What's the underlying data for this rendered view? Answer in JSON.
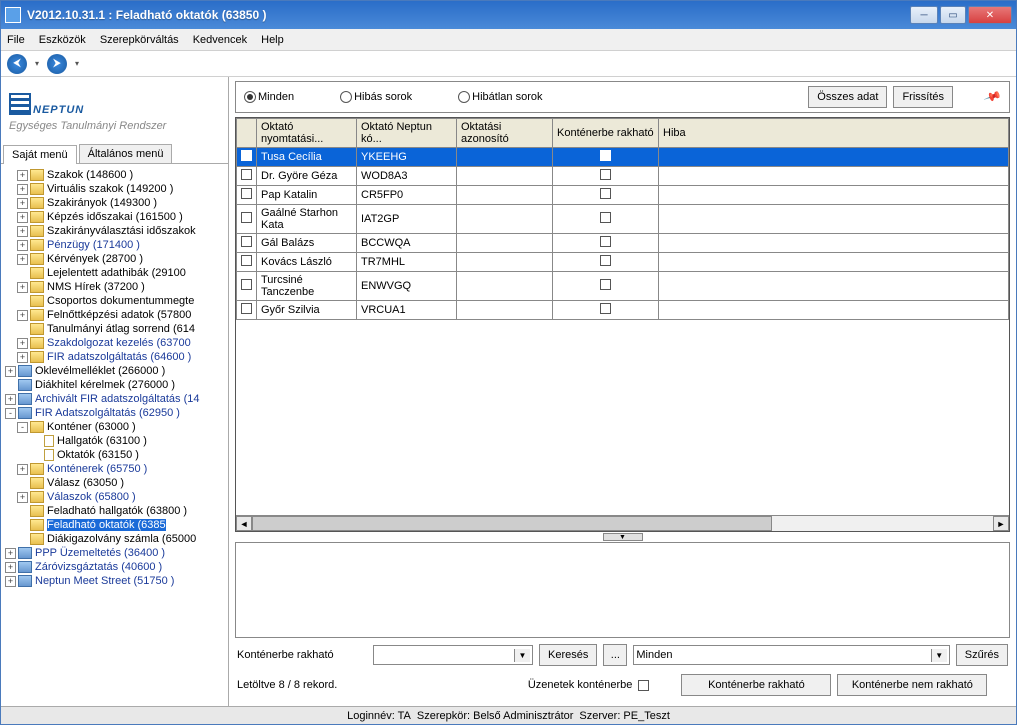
{
  "title": "V2012.10.31.1 : Feladható oktatók (63850  )",
  "menu": [
    "File",
    "Eszközök",
    "Szerepkörváltás",
    "Kedvencek",
    "Help"
  ],
  "logo": {
    "text": "NEPTUN",
    "sub": "Egységes Tanulmányi Rendszer"
  },
  "leftTabs": [
    "Saját menü",
    "Általános menü"
  ],
  "tree": [
    {
      "ind": 1,
      "exp": "+",
      "icon": "folder",
      "label": "Szakok (148600  )",
      "link": false
    },
    {
      "ind": 1,
      "exp": "+",
      "icon": "folder",
      "label": "Virtuális szakok (149200  )",
      "link": false
    },
    {
      "ind": 1,
      "exp": "+",
      "icon": "folder",
      "label": "Szakirányok (149300  )",
      "link": false
    },
    {
      "ind": 1,
      "exp": "+",
      "icon": "folder",
      "label": "Képzés időszakai (161500  )",
      "link": false
    },
    {
      "ind": 1,
      "exp": "+",
      "icon": "folder",
      "label": "Szakirányválasztási időszakok",
      "link": false
    },
    {
      "ind": 1,
      "exp": "+",
      "icon": "folder",
      "label": "Pénzügy (171400  )",
      "link": true
    },
    {
      "ind": 1,
      "exp": "+",
      "icon": "folder",
      "label": "Kérvények (28700  )",
      "link": false
    },
    {
      "ind": 1,
      "exp": "",
      "icon": "folder",
      "label": "Lejelentett adathibák (29100",
      "link": false
    },
    {
      "ind": 1,
      "exp": "+",
      "icon": "folder",
      "label": "NMS Hírek (37200  )",
      "link": false
    },
    {
      "ind": 1,
      "exp": "",
      "icon": "folder",
      "label": "Csoportos dokumentummegte",
      "link": false
    },
    {
      "ind": 1,
      "exp": "+",
      "icon": "folder",
      "label": "Felnőttképzési adatok (57800",
      "link": false
    },
    {
      "ind": 1,
      "exp": "",
      "icon": "folder",
      "label": "Tanulmányi átlag sorrend (614",
      "link": false
    },
    {
      "ind": 1,
      "exp": "+",
      "icon": "folder",
      "label": "Szakdolgozat kezelés (63700",
      "link": true
    },
    {
      "ind": 1,
      "exp": "+",
      "icon": "folder",
      "label": "FIR adatszolgáltatás (64600  )",
      "link": true
    },
    {
      "ind": 0,
      "exp": "+",
      "icon": "folderblue",
      "label": "Oklevélmelléklet (266000  )",
      "link": false
    },
    {
      "ind": 0,
      "exp": "",
      "icon": "folderblue",
      "label": "Diákhitel kérelmek (276000  )",
      "link": false
    },
    {
      "ind": 0,
      "exp": "+",
      "icon": "folderblue",
      "label": "Archivált FIR adatszolgáltatás (14",
      "link": true
    },
    {
      "ind": 0,
      "exp": "-",
      "icon": "folderblue",
      "label": "FIR Adatszolgáltatás (62950  )",
      "link": true
    },
    {
      "ind": 1,
      "exp": "-",
      "icon": "folder",
      "label": "Konténer (63000  )",
      "link": false
    },
    {
      "ind": 2,
      "exp": "",
      "icon": "doc",
      "label": "Hallgatók (63100  )",
      "link": false
    },
    {
      "ind": 2,
      "exp": "",
      "icon": "doc",
      "label": "Oktatók (63150  )",
      "link": false
    },
    {
      "ind": 1,
      "exp": "+",
      "icon": "folder",
      "label": "Konténerek (65750  )",
      "link": true
    },
    {
      "ind": 1,
      "exp": "",
      "icon": "folder",
      "label": "Válasz (63050  )",
      "link": false
    },
    {
      "ind": 1,
      "exp": "+",
      "icon": "folder",
      "label": "Válaszok (65800  )",
      "link": true
    },
    {
      "ind": 1,
      "exp": "",
      "icon": "folder",
      "label": "Feladható hallgatók (63800  )",
      "link": false
    },
    {
      "ind": 1,
      "exp": "",
      "icon": "folder",
      "label": "Feladható oktatók (6385",
      "link": false,
      "selected": true
    },
    {
      "ind": 1,
      "exp": "",
      "icon": "folder",
      "label": "Diákigazolvány számla (65000",
      "link": false
    },
    {
      "ind": 0,
      "exp": "+",
      "icon": "folderblue",
      "label": "PPP Üzemeltetés (36400  )",
      "link": true
    },
    {
      "ind": 0,
      "exp": "+",
      "icon": "folderblue",
      "label": "Záróvizsgáztatás (40600  )",
      "link": true
    },
    {
      "ind": 0,
      "exp": "+",
      "icon": "folderblue",
      "label": "Neptun Meet Street (51750  )",
      "link": true
    }
  ],
  "filter": {
    "opt1": "Minden",
    "opt2": "Hibás sorok",
    "opt3": "Hibátlan sorok",
    "btnAll": "Összes adat",
    "btnRefresh": "Frissítés"
  },
  "columns": [
    "",
    "Oktató nyomtatási...",
    "Oktató Neptun kó...",
    "Oktatási azonosító",
    "Konténerbe rakható",
    "Hiba"
  ],
  "rows": [
    {
      "name": "Tusa Cecília",
      "code": "YKEEHG",
      "selected": true
    },
    {
      "name": "Dr. Györe Géza",
      "code": "WOD8A3"
    },
    {
      "name": "Pap Katalin",
      "code": "CR5FP0"
    },
    {
      "name": "Gaálné Starhon Kata",
      "code": "IAT2GP"
    },
    {
      "name": "Gál Balázs",
      "code": "BCCWQA"
    },
    {
      "name": "Kovács László",
      "code": "TR7MHL"
    },
    {
      "name": "Turcsiné Tanczenbe",
      "code": "ENWVGQ"
    },
    {
      "name": "Győr Szilvia",
      "code": "VRCUA1"
    }
  ],
  "bottom": {
    "label1": "Konténerbe rakható",
    "btnSearch": "Keresés",
    "btnDots": "...",
    "comboVal": "Minden",
    "btnFilter": "Szűrés",
    "recordText": "Letöltve 8 / 8 rekord.",
    "label2": "Üzenetek konténerbe",
    "btnYes": "Konténerbe rakható",
    "btnNo": "Konténerbe nem rakható"
  },
  "status": {
    "login": "Loginnév: TA",
    "role": "Szerepkör: Belső Adminisztrátor",
    "server": "Szerver: PE_Teszt"
  }
}
